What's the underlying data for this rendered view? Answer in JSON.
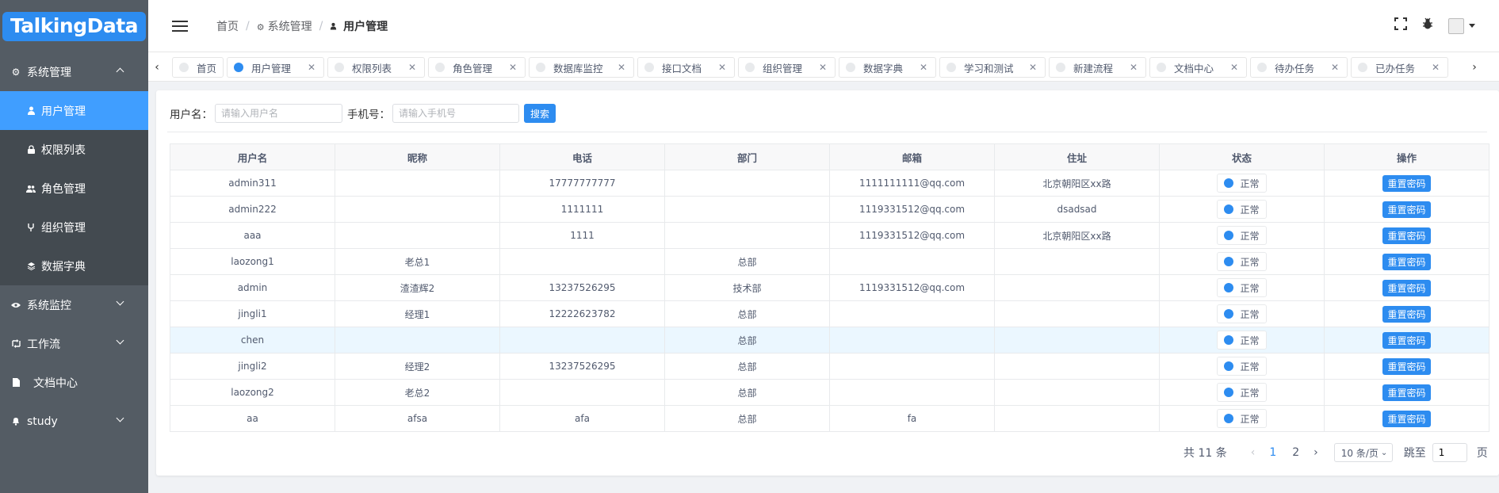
{
  "logo": "TalkingData",
  "sidebar": {
    "groups": [
      {
        "label": "系统管理",
        "icon": "gear-icon",
        "expanded": true
      },
      {
        "label": "系统监控",
        "icon": "eye-icon",
        "expanded": false
      },
      {
        "label": "工作流",
        "icon": "workflow-icon",
        "expanded": false
      },
      {
        "label": "文档中心",
        "icon": "document-icon",
        "expanded": false
      },
      {
        "label": "study",
        "icon": "bell-icon",
        "expanded": false
      }
    ],
    "sub_items": [
      {
        "label": "用户管理",
        "icon": "user-icon",
        "active": true
      },
      {
        "label": "权限列表",
        "icon": "lock-icon",
        "active": false
      },
      {
        "label": "角色管理",
        "icon": "users-icon",
        "active": false
      },
      {
        "label": "组织管理",
        "icon": "fork-icon",
        "active": false
      },
      {
        "label": "数据字典",
        "icon": "layers-icon",
        "active": false
      }
    ]
  },
  "header": {
    "breadcrumb": [
      "首页",
      "系统管理",
      "用户管理"
    ]
  },
  "tabs": [
    {
      "label": "首页",
      "active": false,
      "closable": false
    },
    {
      "label": "用户管理",
      "active": true,
      "closable": true
    },
    {
      "label": "权限列表",
      "active": false,
      "closable": true
    },
    {
      "label": "角色管理",
      "active": false,
      "closable": true
    },
    {
      "label": "数据库监控",
      "active": false,
      "closable": true
    },
    {
      "label": "接口文档",
      "active": false,
      "closable": true
    },
    {
      "label": "组织管理",
      "active": false,
      "closable": true
    },
    {
      "label": "数据字典",
      "active": false,
      "closable": true
    },
    {
      "label": "学习和测试",
      "active": false,
      "closable": true
    },
    {
      "label": "新建流程",
      "active": false,
      "closable": true
    },
    {
      "label": "文档中心",
      "active": false,
      "closable": true
    },
    {
      "label": "待办任务",
      "active": false,
      "closable": true
    },
    {
      "label": "已办任务",
      "active": false,
      "closable": true
    }
  ],
  "search": {
    "username_label": "用户名：",
    "username_placeholder": "请输入用户名",
    "phone_label": "手机号：",
    "phone_placeholder": "请输入手机号",
    "button": "搜索"
  },
  "table": {
    "columns": [
      "用户名",
      "昵称",
      "电话",
      "部门",
      "邮箱",
      "住址",
      "状态",
      "操作"
    ],
    "status_label": "正常",
    "action_label": "重置密码",
    "rows": [
      [
        "admin311",
        "",
        "17777777777",
        "",
        "1111111111@qq.com",
        "北京朝阳区xx路"
      ],
      [
        "admin222",
        "",
        "1111111",
        "",
        "1119331512@qq.com",
        "dsadsad"
      ],
      [
        "aaa",
        "",
        "1111",
        "",
        "1119331512@qq.com",
        "北京朝阳区xx路"
      ],
      [
        "laozong1",
        "老总1",
        "",
        "总部",
        "",
        ""
      ],
      [
        "admin",
        "渣渣辉2",
        "13237526295",
        "技术部",
        "1119331512@qq.com",
        ""
      ],
      [
        "jingli1",
        "经理1",
        "12222623782",
        "总部",
        "",
        ""
      ],
      [
        "chen",
        "",
        "",
        "总部",
        "",
        ""
      ],
      [
        "jingli2",
        "经理2",
        "13237526295",
        "总部",
        "",
        ""
      ],
      [
        "laozong2",
        "老总2",
        "",
        "总部",
        "",
        ""
      ],
      [
        "aa",
        "afsa",
        "afa",
        "总部",
        "fa",
        ""
      ]
    ],
    "highlighted_row": 6
  },
  "pagination": {
    "total": "共 11 条",
    "pages": [
      "1",
      "2"
    ],
    "current": "1",
    "page_size": "10 条/页",
    "jump_label": "跳至",
    "jump_value": "1",
    "unit": "页"
  },
  "colors": {
    "primary": "#2d8cf0",
    "sidebar_bg": "#545c64",
    "submenu_bg": "#434a50",
    "active_item": "#409eff"
  }
}
